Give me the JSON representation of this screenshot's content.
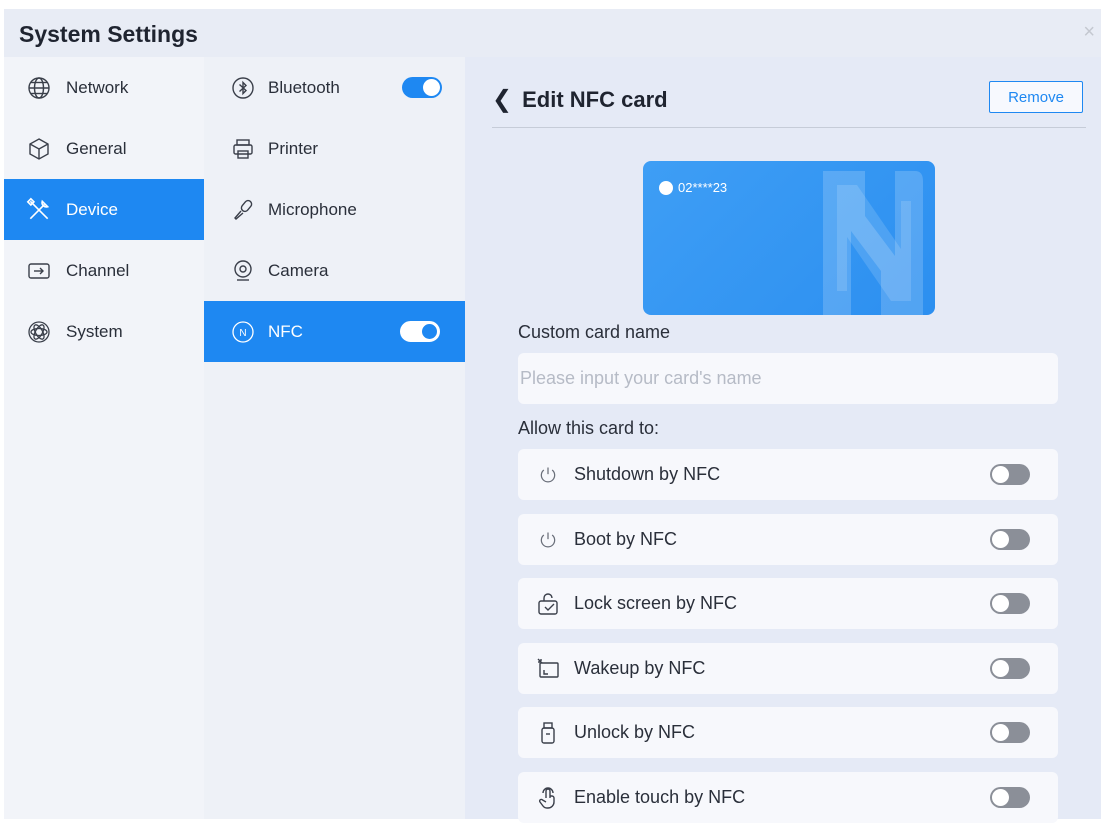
{
  "window": {
    "title": "System Settings",
    "close_symbol": "×"
  },
  "nav": {
    "items": [
      {
        "label": "Network",
        "icon": "globe-icon"
      },
      {
        "label": "General",
        "icon": "cube-icon"
      },
      {
        "label": "Device",
        "icon": "tools-icon",
        "active": true
      },
      {
        "label": "Channel",
        "icon": "input-icon"
      },
      {
        "label": "System",
        "icon": "atom-icon"
      }
    ]
  },
  "devices": {
    "items": [
      {
        "label": "Bluetooth",
        "icon": "bluetooth-icon",
        "toggle": true
      },
      {
        "label": "Printer",
        "icon": "printer-icon"
      },
      {
        "label": "Microphone",
        "icon": "microphone-icon"
      },
      {
        "label": "Camera",
        "icon": "camera-icon"
      },
      {
        "label": "NFC",
        "icon": "nfc-icon",
        "toggle": true,
        "active": true
      }
    ]
  },
  "edit": {
    "back_symbol": "❮",
    "title": "Edit NFC card",
    "remove_label": "Remove",
    "card": {
      "number": "02****23",
      "color": "#2c8ff0"
    },
    "name_label": "Custom card name",
    "name_placeholder": "Please input your card's name",
    "name_value": "",
    "allow_label": "Allow this card to:",
    "permissions": [
      {
        "label": "Shutdown by NFC",
        "icon": "power-icon",
        "enabled": false
      },
      {
        "label": "Boot by NFC",
        "icon": "power-icon",
        "enabled": false
      },
      {
        "label": "Lock screen by NFC",
        "icon": "lock-screen-icon",
        "enabled": false
      },
      {
        "label": "Wakeup by NFC",
        "icon": "wakeup-icon",
        "enabled": false
      },
      {
        "label": "Unlock by NFC",
        "icon": "usb-key-icon",
        "enabled": false
      },
      {
        "label": "Enable touch by NFC",
        "icon": "touch-icon",
        "enabled": false
      }
    ]
  },
  "colors": {
    "accent": "#1e88f2",
    "toggle_off": "#8b8f98"
  }
}
